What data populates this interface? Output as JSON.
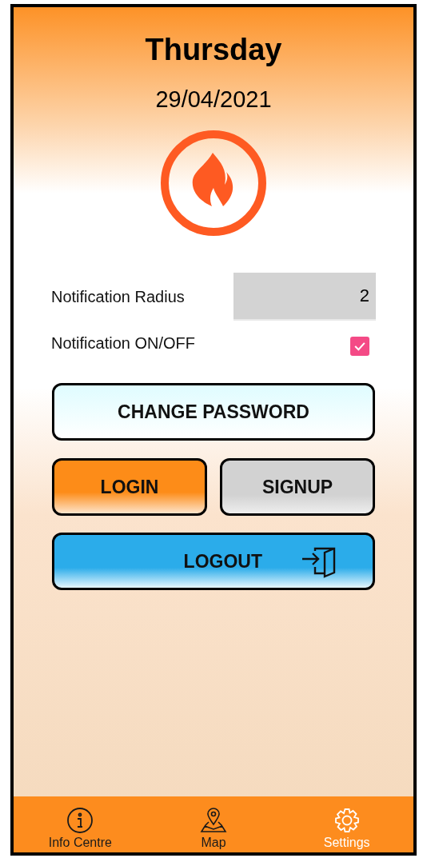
{
  "header": {
    "day": "Thursday",
    "date": "29/04/2021"
  },
  "settings": {
    "radius": {
      "label": "Notification Radius",
      "value": "2"
    },
    "notification": {
      "label": "Notification ON/OFF",
      "checked": true
    }
  },
  "buttons": [
    {
      "label": "CHANGE PASSWORD",
      "kind": "wide"
    },
    {
      "label": "LOGIN",
      "kind": "login"
    },
    {
      "label": "SIGNUP",
      "kind": "signup"
    },
    {
      "label": "LOGOUT",
      "kind": "logout"
    }
  ],
  "nav": [
    {
      "label": "Info Centre",
      "kind": "info",
      "selected": false
    },
    {
      "label": "Map",
      "kind": "map",
      "selected": false
    },
    {
      "label": "Settings",
      "kind": "settings",
      "selected": true
    }
  ]
}
